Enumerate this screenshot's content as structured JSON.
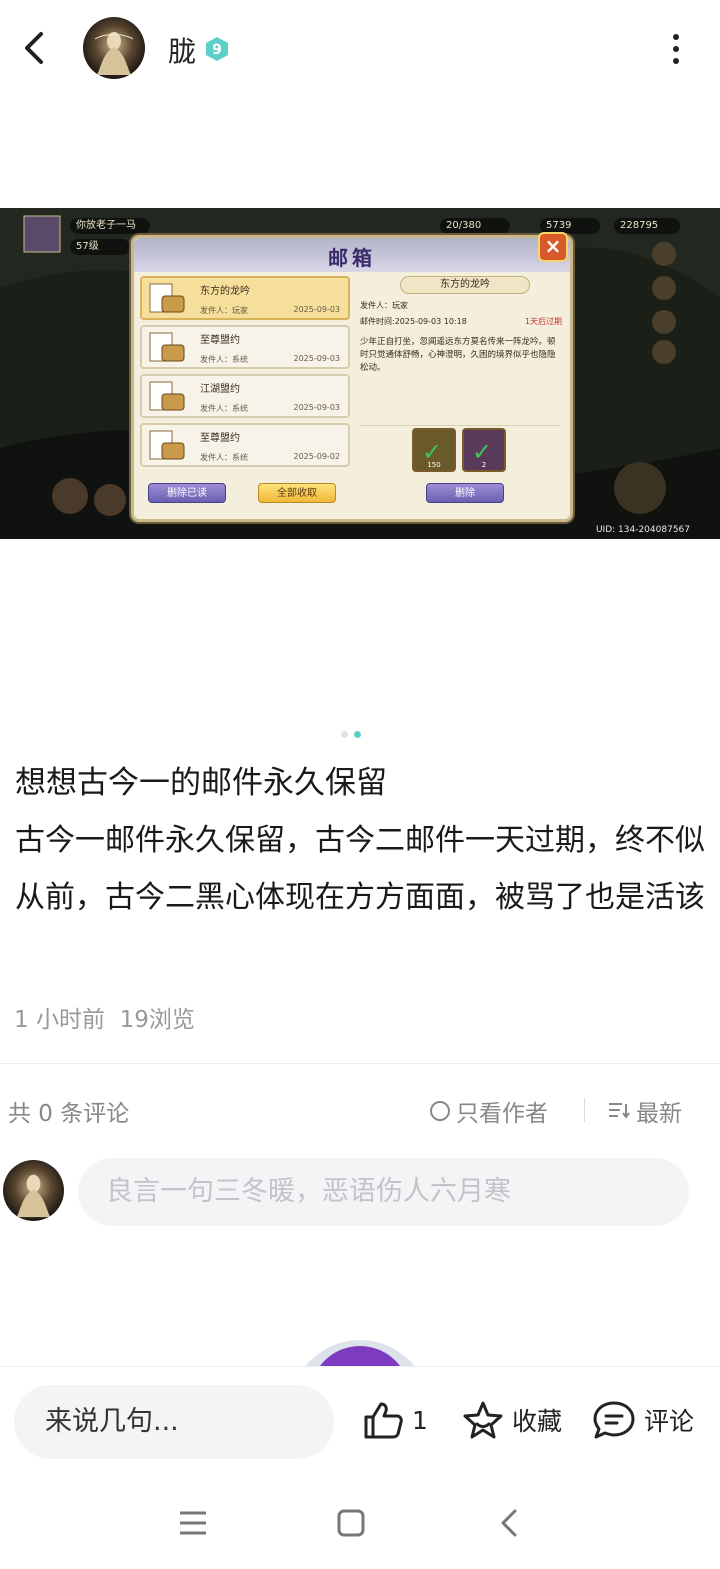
{
  "header": {
    "username": "胧",
    "level": "9"
  },
  "game_screenshot": {
    "hud": {
      "player_name": "你放老子一马",
      "player_level": "57级",
      "stamina": "20/380",
      "gold": "5739",
      "silver": "228795"
    },
    "mailbox": {
      "title": "邮箱",
      "close_icon": "×",
      "mails": [
        {
          "subject": "东方的龙吟",
          "sender": "发件人：玩家",
          "date": "2025-09-03"
        },
        {
          "subject": "至尊盟约",
          "sender": "发件人：系统",
          "date": "2025-09-03"
        },
        {
          "subject": "江湖盟约",
          "sender": "发件人：系统",
          "date": "2025-09-03"
        },
        {
          "subject": "至尊盟约",
          "sender": "发件人：系统",
          "date": "2025-09-02"
        }
      ],
      "detail": {
        "title": "东方的龙吟",
        "sender": "发件人：玩家",
        "time": "邮件时间:2025-09-03 10:18",
        "expire": "1天后过期",
        "body": "少年正自打坐，忽闻遥远东方莫名传来一阵龙吟。顿时只觉通体舒畅，心神澄明，久困的境界似乎也隐隐松动。",
        "rewards": [
          {
            "count": "150"
          },
          {
            "count": "2"
          }
        ]
      },
      "buttons": {
        "delete_read": "删除已读",
        "collect_all": "全部收取",
        "delete": "删除"
      }
    },
    "uid": "UID: 134-204087567"
  },
  "post": {
    "title": "想想古今一的邮件永久保留",
    "body": "古今一邮件永久保留，古今二邮件一天过期，终不似从前，古今二黑心体现在方方面面，被骂了也是活该",
    "time": "1 小时前",
    "views": "19浏览"
  },
  "comments": {
    "count_label": "共 0 条评论",
    "author_only": "只看作者",
    "sort": "最新",
    "input_placeholder": "良言一句三冬暖，恶语伤人六月寒"
  },
  "action_bar": {
    "say_placeholder": "来说几句...",
    "like_count": "1",
    "favorite_label": "收藏",
    "comment_label": "评论"
  },
  "colors": {
    "accent_teal": "#5ccfc7",
    "text_primary": "#1a1a1a",
    "text_secondary": "#999999",
    "input_bg": "#f3f4f6"
  }
}
